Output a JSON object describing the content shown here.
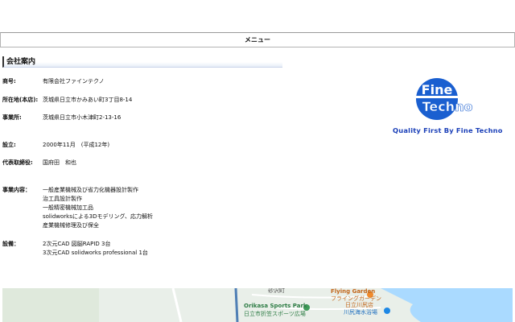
{
  "menu": {
    "label": "メニュー"
  },
  "section": {
    "title": "会社案内"
  },
  "company": {
    "name_label": "商号:",
    "name_value": "有限会社ファインテクノ",
    "hq_label": "所在地(本店):",
    "hq_value": "茨城県日立市かみあい町3丁目8-14",
    "office_label": "事業所:",
    "office_value": "茨城県日立市小木津町2-13-16",
    "established_label": "設立:",
    "established_value": "2000年11月　(平成12年)",
    "ceo_label": "代表取締役:",
    "ceo_value": "国府田　和也",
    "business_label": "事業内容：",
    "business_items": [
      "一般産業機械及び省力化機器設計製作",
      "治工具設計製作",
      "一般精密機械加工品",
      "solidworksによる3Dモデリング、応力解析",
      "産業機械修理及び保全"
    ],
    "equipment_label": "設備：",
    "equipment_items": [
      "2次元CAD 図脳RAPID 3台",
      "3次元CAD solidworks professional 1台"
    ]
  },
  "logo": {
    "line1": "Fine",
    "line2": "Techno",
    "tagline": "Quality First By Fine Techno",
    "icon": "fine-techno-logo",
    "colors": {
      "blue": "#1a5fd0",
      "white": "#ffffff",
      "tagline": "#1a3fb8"
    }
  },
  "map": {
    "labels": {
      "flying_garden_en": "Flying Garden",
      "flying_garden_jp": "フライングガーデン",
      "flying_garden_sub": "日立川尻店",
      "sports_park_en": "Orikasa Sports Park",
      "sports_park_jp": "日立市折笠スポーツ広場",
      "beach": "川尻海水浴場",
      "district": "砂沢町"
    },
    "colors": {
      "land": "#e9efe9",
      "sea": "#aadaff",
      "road": "#ffffff",
      "highway": "#4f7fb5",
      "poi_orange": "#f08a2c",
      "poi_green": "#3f9b5a"
    }
  }
}
